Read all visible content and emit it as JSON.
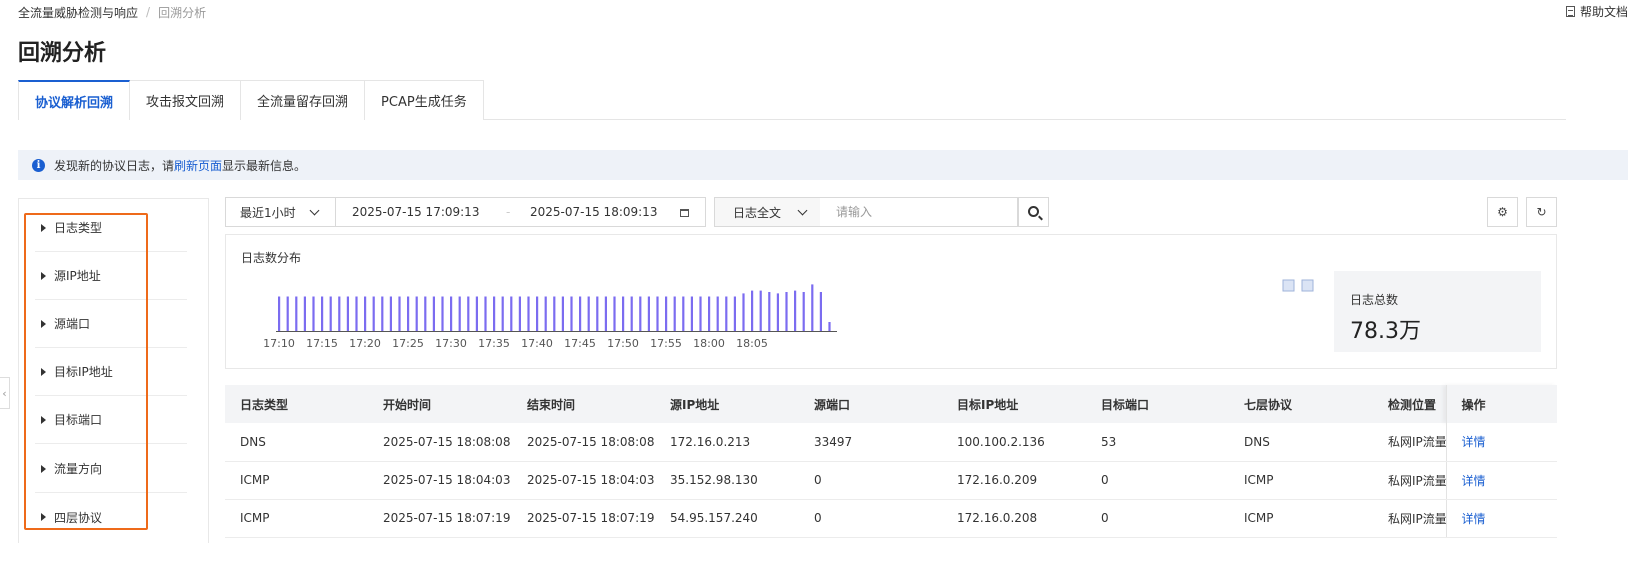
{
  "breadcrumb": {
    "root": "全流量威胁检测与响应",
    "separator": "/",
    "current": "回溯分析"
  },
  "help": {
    "label": "帮助文档"
  },
  "page_title": "回溯分析",
  "tabs": [
    {
      "label": "协议解析回溯",
      "active": true
    },
    {
      "label": "攻击报文回溯",
      "active": false
    },
    {
      "label": "全流量留存回溯",
      "active": false
    },
    {
      "label": "PCAP生成任务",
      "active": false
    }
  ],
  "notice": {
    "prefix": "发现新的协议日志，请",
    "link": "刷新页面",
    "suffix": "显示最新信息。"
  },
  "filters": [
    "日志类型",
    "源IP地址",
    "源端口",
    "目标IP地址",
    "目标端口",
    "流量方向",
    "四层协议"
  ],
  "search": {
    "time_range": "最近1小时",
    "start_time": "2025-07-15 17:09:13",
    "end_time": "2025-07-15 18:09:13",
    "date_separator": "-",
    "field": "日志全文",
    "placeholder": "请输入"
  },
  "chart_data": {
    "type": "bar",
    "title": "日志数分布",
    "x_tick_labels": [
      "17:10",
      "17:15",
      "17:20",
      "17:25",
      "17:30",
      "17:35",
      "17:40",
      "17:45",
      "17:50",
      "17:55",
      "18:00",
      "18:05"
    ],
    "x_start_minute": 10,
    "bucket_minutes": 1,
    "values": [
      1.0,
      1.0,
      1.0,
      1.0,
      1.0,
      1.0,
      1.0,
      1.0,
      1.0,
      1.0,
      1.0,
      1.0,
      1.0,
      1.0,
      1.0,
      1.0,
      1.0,
      1.0,
      1.0,
      1.0,
      1.0,
      1.0,
      1.0,
      1.0,
      1.0,
      1.0,
      1.0,
      1.0,
      1.0,
      1.0,
      1.0,
      1.0,
      1.0,
      1.0,
      1.0,
      1.0,
      1.0,
      1.0,
      1.0,
      1.0,
      1.0,
      1.0,
      1.0,
      1.0,
      1.0,
      1.0,
      1.0,
      1.0,
      1.0,
      1.0,
      1.0,
      1.0,
      1.0,
      1.0,
      1.09,
      1.17,
      1.17,
      1.13,
      1.09,
      1.13,
      1.17,
      1.13,
      1.35,
      1.13,
      0.26
    ],
    "ylim": [
      0,
      1.5
    ],
    "bar_color": "#7b6cf0"
  },
  "summary": {
    "label": "日志总数",
    "value": "78.3万"
  },
  "table": {
    "columns": [
      "日志类型",
      "开始时间",
      "结束时间",
      "源IP地址",
      "源端口",
      "目标IP地址",
      "目标端口",
      "七层协议",
      "检测位置",
      "操作"
    ],
    "rows": [
      [
        "DNS",
        "2025-07-15 18:08:08",
        "2025-07-15 18:08:08",
        "172.16.0.213",
        "33497",
        "100.100.2.136",
        "53",
        "DNS",
        "私网IP流量",
        "详情"
      ],
      [
        "ICMP",
        "2025-07-15 18:04:03",
        "2025-07-15 18:04:03",
        "35.152.98.130",
        "0",
        "172.16.0.209",
        "0",
        "ICMP",
        "私网IP流量",
        "详情"
      ],
      [
        "ICMP",
        "2025-07-15 18:07:19",
        "2025-07-15 18:07:19",
        "54.95.157.240",
        "0",
        "172.16.0.208",
        "0",
        "ICMP",
        "私网IP流量",
        "详情"
      ]
    ]
  }
}
